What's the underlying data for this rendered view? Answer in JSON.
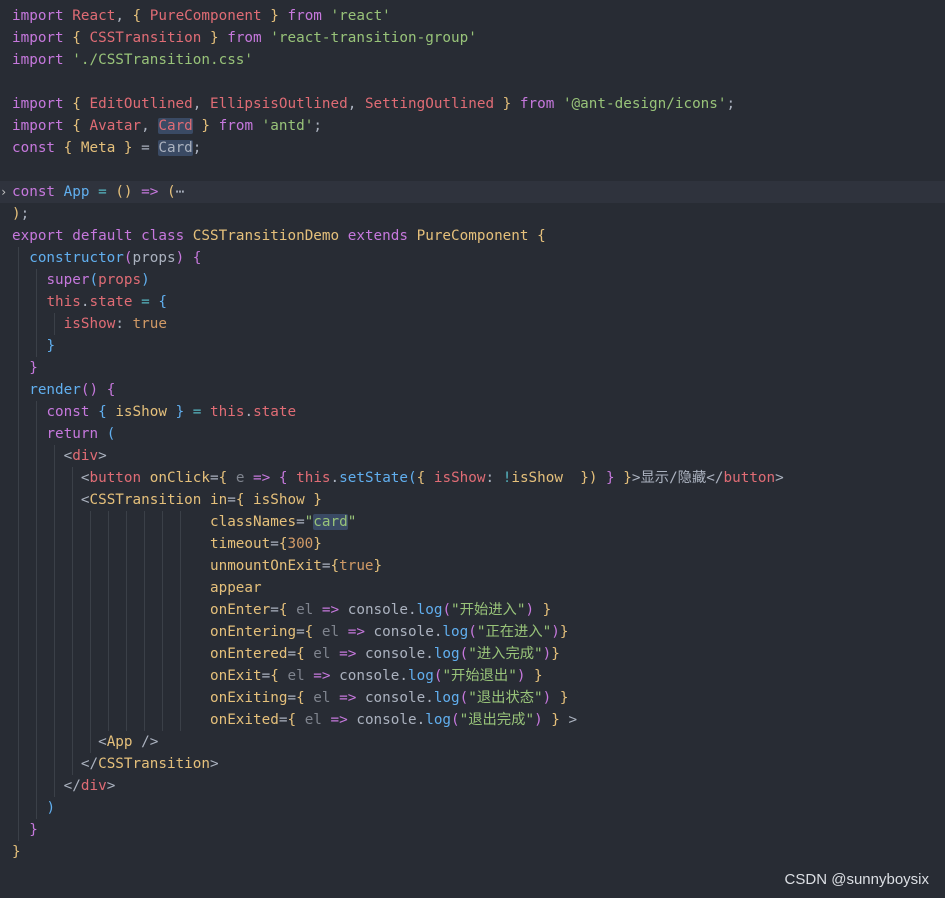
{
  "editor": {
    "colors": {
      "background": "#282c34",
      "current_line": "#2f333d",
      "keyword": "#c678dd",
      "variable": "#e06c75",
      "function": "#61afef",
      "string": "#98c379",
      "number": "#d19a66",
      "type": "#e5c07b",
      "operator": "#56b6c2",
      "plain": "#abb2bf",
      "param": "#7f848e"
    },
    "fold_icon": "chevron-right-icon",
    "lines": [
      {
        "tokens": [
          [
            "import ",
            "keyword"
          ],
          [
            "React",
            "variable"
          ],
          [
            ", ",
            "plain"
          ],
          [
            "{ ",
            "bracket1"
          ],
          [
            "PureComponent",
            "variable"
          ],
          [
            " }",
            "bracket1"
          ],
          [
            " from ",
            "keyword"
          ],
          [
            "'react'",
            "string"
          ]
        ]
      },
      {
        "tokens": [
          [
            "import ",
            "keyword"
          ],
          [
            "{ ",
            "bracket1"
          ],
          [
            "CSSTransition",
            "variable"
          ],
          [
            " }",
            "bracket1"
          ],
          [
            " from ",
            "keyword"
          ],
          [
            "'react-transition-group'",
            "string"
          ]
        ]
      },
      {
        "tokens": [
          [
            "import ",
            "keyword"
          ],
          [
            "'./CSSTransition.css'",
            "string"
          ]
        ]
      },
      {
        "tokens": []
      },
      {
        "tokens": [
          [
            "import ",
            "keyword"
          ],
          [
            "{ ",
            "bracket1"
          ],
          [
            "EditOutlined",
            "variable"
          ],
          [
            ", ",
            "plain"
          ],
          [
            "EllipsisOutlined",
            "variable"
          ],
          [
            ", ",
            "plain"
          ],
          [
            "SettingOutlined",
            "variable"
          ],
          [
            " }",
            "bracket1"
          ],
          [
            " from ",
            "keyword"
          ],
          [
            "'@ant-design/icons'",
            "string"
          ],
          [
            ";",
            "plain"
          ]
        ]
      },
      {
        "tokens": [
          [
            "import ",
            "keyword"
          ],
          [
            "{ ",
            "bracket1"
          ],
          [
            "Avatar",
            "variable"
          ],
          [
            ", ",
            "plain"
          ],
          [
            "Card",
            "variable-sel"
          ],
          [
            " }",
            "bracket1"
          ],
          [
            " from ",
            "keyword"
          ],
          [
            "'antd'",
            "string"
          ],
          [
            ";",
            "plain"
          ]
        ]
      },
      {
        "tokens": [
          [
            "const ",
            "keyword"
          ],
          [
            "{ ",
            "bracket1"
          ],
          [
            "Meta",
            "type"
          ],
          [
            " }",
            "bracket1"
          ],
          [
            " = ",
            "plain"
          ],
          [
            "Card",
            "plain-sel"
          ],
          [
            ";",
            "plain"
          ]
        ]
      },
      {
        "tokens": []
      },
      {
        "highlight": true,
        "fold": true,
        "tokens": [
          [
            "const ",
            "keyword"
          ],
          [
            "App",
            "function"
          ],
          [
            " = ",
            "operator"
          ],
          [
            "()",
            "bracket1"
          ],
          [
            " => ",
            "keyword"
          ],
          [
            "(",
            "bracket1"
          ],
          [
            "⋯",
            "plain"
          ]
        ]
      },
      {
        "tokens": [
          [
            ")",
            "bracket1"
          ],
          [
            ";",
            "plain"
          ]
        ]
      },
      {
        "tokens": [
          [
            "export ",
            "keyword"
          ],
          [
            "default ",
            "keyword"
          ],
          [
            "class ",
            "keyword"
          ],
          [
            "CSSTransitionDemo ",
            "type"
          ],
          [
            "extends ",
            "keyword"
          ],
          [
            "PureComponent ",
            "type"
          ],
          [
            "{",
            "bracket1"
          ]
        ]
      },
      {
        "indent": 1,
        "tokens": [
          [
            "  "
          ],
          [
            "constructor",
            "function"
          ],
          [
            "(",
            "bracket2"
          ],
          [
            "props",
            "plain"
          ],
          [
            ")",
            "bracket2"
          ],
          [
            " ",
            "plain"
          ],
          [
            "{",
            "bracket2"
          ]
        ]
      },
      {
        "indent": 2,
        "tokens": [
          [
            "    "
          ],
          [
            "super",
            "keyword"
          ],
          [
            "(",
            "bracket3"
          ],
          [
            "props",
            "variable"
          ],
          [
            ")",
            "bracket3"
          ]
        ]
      },
      {
        "indent": 2,
        "tokens": [
          [
            "    "
          ],
          [
            "this",
            "variable"
          ],
          [
            ".",
            "plain"
          ],
          [
            "state",
            "variable"
          ],
          [
            " = ",
            "operator"
          ],
          [
            "{",
            "bracket3"
          ]
        ]
      },
      {
        "indent": 3,
        "tokens": [
          [
            "      "
          ],
          [
            "isShow",
            "variable"
          ],
          [
            ": ",
            "plain"
          ],
          [
            "true",
            "number"
          ]
        ]
      },
      {
        "indent": 2,
        "tokens": [
          [
            "    "
          ],
          [
            "}",
            "bracket3"
          ]
        ]
      },
      {
        "indent": 1,
        "tokens": [
          [
            "  "
          ],
          [
            "}",
            "bracket2"
          ]
        ]
      },
      {
        "indent": 1,
        "tokens": [
          [
            "  "
          ],
          [
            "render",
            "function"
          ],
          [
            "()",
            "bracket2"
          ],
          [
            " ",
            "plain"
          ],
          [
            "{",
            "bracket2"
          ]
        ]
      },
      {
        "indent": 2,
        "tokens": [
          [
            "    "
          ],
          [
            "const ",
            "keyword"
          ],
          [
            "{ ",
            "bracket3"
          ],
          [
            "isShow",
            "type"
          ],
          [
            " }",
            "bracket3"
          ],
          [
            " = ",
            "operator"
          ],
          [
            "this",
            "variable"
          ],
          [
            ".",
            "plain"
          ],
          [
            "state",
            "variable"
          ]
        ]
      },
      {
        "indent": 2,
        "tokens": [
          [
            "    "
          ],
          [
            "return ",
            "keyword"
          ],
          [
            "(",
            "bracket3"
          ]
        ]
      },
      {
        "indent": 3,
        "tokens": [
          [
            "      "
          ],
          [
            "<",
            "plain"
          ],
          [
            "div",
            "variable"
          ],
          [
            ">",
            "plain"
          ]
        ]
      },
      {
        "indent": 4,
        "tokens": [
          [
            "        "
          ],
          [
            "<",
            "plain"
          ],
          [
            "button ",
            "variable"
          ],
          [
            "onClick",
            "type"
          ],
          [
            "=",
            "plain"
          ],
          [
            "{ ",
            "bracket1"
          ],
          [
            "e",
            "param"
          ],
          [
            " => ",
            "keyword"
          ],
          [
            "{ ",
            "bracket2"
          ],
          [
            "this",
            "variable"
          ],
          [
            ".",
            "plain"
          ],
          [
            "setState",
            "function"
          ],
          [
            "(",
            "bracket3"
          ],
          [
            "{ ",
            "bracket1"
          ],
          [
            "isShow",
            "variable"
          ],
          [
            ": ",
            "plain"
          ],
          [
            "!",
            "operator"
          ],
          [
            "isShow",
            "type"
          ],
          [
            "  ",
            "plain"
          ],
          [
            "})",
            "bracket1"
          ],
          [
            " }",
            "bracket2"
          ],
          [
            " }",
            "bracket1"
          ],
          [
            ">显示/隐藏</",
            "plain"
          ],
          [
            "button",
            "variable"
          ],
          [
            ">",
            "plain"
          ]
        ]
      },
      {
        "indent": 4,
        "tokens": [
          [
            "        "
          ],
          [
            "<",
            "plain"
          ],
          [
            "CSSTransition ",
            "type"
          ],
          [
            "in",
            "type"
          ],
          [
            "=",
            "plain"
          ],
          [
            "{ ",
            "bracket1"
          ],
          [
            "isShow",
            "type"
          ],
          [
            " }",
            "bracket1"
          ]
        ]
      },
      {
        "indent": 5,
        "deep": true,
        "tokens": [
          [
            "                       "
          ],
          [
            "classNames",
            "type"
          ],
          [
            "=",
            "plain"
          ],
          [
            "\"",
            "string"
          ],
          [
            "card",
            "string-sel"
          ],
          [
            "\"",
            "string"
          ]
        ]
      },
      {
        "indent": 5,
        "deep": true,
        "tokens": [
          [
            "                       "
          ],
          [
            "timeout",
            "type"
          ],
          [
            "=",
            "plain"
          ],
          [
            "{",
            "bracket1"
          ],
          [
            "300",
            "number"
          ],
          [
            "}",
            "bracket1"
          ]
        ]
      },
      {
        "indent": 5,
        "deep": true,
        "tokens": [
          [
            "                       "
          ],
          [
            "unmountOnExit",
            "type"
          ],
          [
            "=",
            "plain"
          ],
          [
            "{",
            "bracket1"
          ],
          [
            "true",
            "number"
          ],
          [
            "}",
            "bracket1"
          ]
        ]
      },
      {
        "indent": 5,
        "deep": true,
        "tokens": [
          [
            "                       "
          ],
          [
            "appear",
            "type"
          ]
        ]
      },
      {
        "indent": 5,
        "deep": true,
        "tokens": [
          [
            "                       "
          ],
          [
            "onEnter",
            "type"
          ],
          [
            "=",
            "plain"
          ],
          [
            "{ ",
            "bracket1"
          ],
          [
            "el",
            "param"
          ],
          [
            " => ",
            "keyword"
          ],
          [
            "console",
            "plain"
          ],
          [
            ".",
            "plain"
          ],
          [
            "log",
            "function"
          ],
          [
            "(",
            "bracket2"
          ],
          [
            "\"开始进入\"",
            "string"
          ],
          [
            ")",
            "bracket2"
          ],
          [
            " }",
            "bracket1"
          ]
        ]
      },
      {
        "indent": 5,
        "deep": true,
        "tokens": [
          [
            "                       "
          ],
          [
            "onEntering",
            "type"
          ],
          [
            "=",
            "plain"
          ],
          [
            "{ ",
            "bracket1"
          ],
          [
            "el",
            "param"
          ],
          [
            " => ",
            "keyword"
          ],
          [
            "console",
            "plain"
          ],
          [
            ".",
            "plain"
          ],
          [
            "log",
            "function"
          ],
          [
            "(",
            "bracket2"
          ],
          [
            "\"正在进入\"",
            "string"
          ],
          [
            ")",
            "bracket2"
          ],
          [
            "}",
            "bracket1"
          ]
        ]
      },
      {
        "indent": 5,
        "deep": true,
        "tokens": [
          [
            "                       "
          ],
          [
            "onEntered",
            "type"
          ],
          [
            "=",
            "plain"
          ],
          [
            "{ ",
            "bracket1"
          ],
          [
            "el",
            "param"
          ],
          [
            " => ",
            "keyword"
          ],
          [
            "console",
            "plain"
          ],
          [
            ".",
            "plain"
          ],
          [
            "log",
            "function"
          ],
          [
            "(",
            "bracket2"
          ],
          [
            "\"进入完成\"",
            "string"
          ],
          [
            ")",
            "bracket2"
          ],
          [
            "}",
            "bracket1"
          ]
        ]
      },
      {
        "indent": 5,
        "deep": true,
        "tokens": [
          [
            "                       "
          ],
          [
            "onExit",
            "type"
          ],
          [
            "=",
            "plain"
          ],
          [
            "{ ",
            "bracket1"
          ],
          [
            "el",
            "param"
          ],
          [
            " => ",
            "keyword"
          ],
          [
            "console",
            "plain"
          ],
          [
            ".",
            "plain"
          ],
          [
            "log",
            "function"
          ],
          [
            "(",
            "bracket2"
          ],
          [
            "\"开始退出\"",
            "string"
          ],
          [
            ")",
            "bracket2"
          ],
          [
            " }",
            "bracket1"
          ]
        ]
      },
      {
        "indent": 5,
        "deep": true,
        "tokens": [
          [
            "                       "
          ],
          [
            "onExiting",
            "type"
          ],
          [
            "=",
            "plain"
          ],
          [
            "{ ",
            "bracket1"
          ],
          [
            "el",
            "param"
          ],
          [
            " => ",
            "keyword"
          ],
          [
            "console",
            "plain"
          ],
          [
            ".",
            "plain"
          ],
          [
            "log",
            "function"
          ],
          [
            "(",
            "bracket2"
          ],
          [
            "\"退出状态\"",
            "string"
          ],
          [
            ")",
            "bracket2"
          ],
          [
            " }",
            "bracket1"
          ]
        ]
      },
      {
        "indent": 5,
        "deep": true,
        "tokens": [
          [
            "                       "
          ],
          [
            "onExited",
            "type"
          ],
          [
            "=",
            "plain"
          ],
          [
            "{ ",
            "bracket1"
          ],
          [
            "el",
            "param"
          ],
          [
            " => ",
            "keyword"
          ],
          [
            "console",
            "plain"
          ],
          [
            ".",
            "plain"
          ],
          [
            "log",
            "function"
          ],
          [
            "(",
            "bracket2"
          ],
          [
            "\"退出完成\"",
            "string"
          ],
          [
            ")",
            "bracket2"
          ],
          [
            " }",
            "bracket1"
          ],
          [
            " >",
            "plain"
          ]
        ]
      },
      {
        "indent": 5,
        "tokens": [
          [
            "          "
          ],
          [
            "<",
            "plain"
          ],
          [
            "App",
            "type"
          ],
          [
            " />",
            "plain"
          ]
        ]
      },
      {
        "indent": 4,
        "tokens": [
          [
            "        "
          ],
          [
            "</",
            "plain"
          ],
          [
            "CSSTransition",
            "type"
          ],
          [
            ">",
            "plain"
          ]
        ]
      },
      {
        "indent": 3,
        "tokens": [
          [
            "      "
          ],
          [
            "</",
            "plain"
          ],
          [
            "div",
            "variable"
          ],
          [
            ">",
            "plain"
          ]
        ]
      },
      {
        "indent": 2,
        "tokens": [
          [
            "    "
          ],
          [
            ")",
            "bracket3"
          ]
        ]
      },
      {
        "indent": 1,
        "tokens": [
          [
            "  "
          ],
          [
            "}",
            "bracket2"
          ]
        ]
      },
      {
        "tokens": [
          [
            "}",
            "bracket1"
          ]
        ]
      }
    ]
  },
  "watermark": "CSDN @sunnyboysix"
}
